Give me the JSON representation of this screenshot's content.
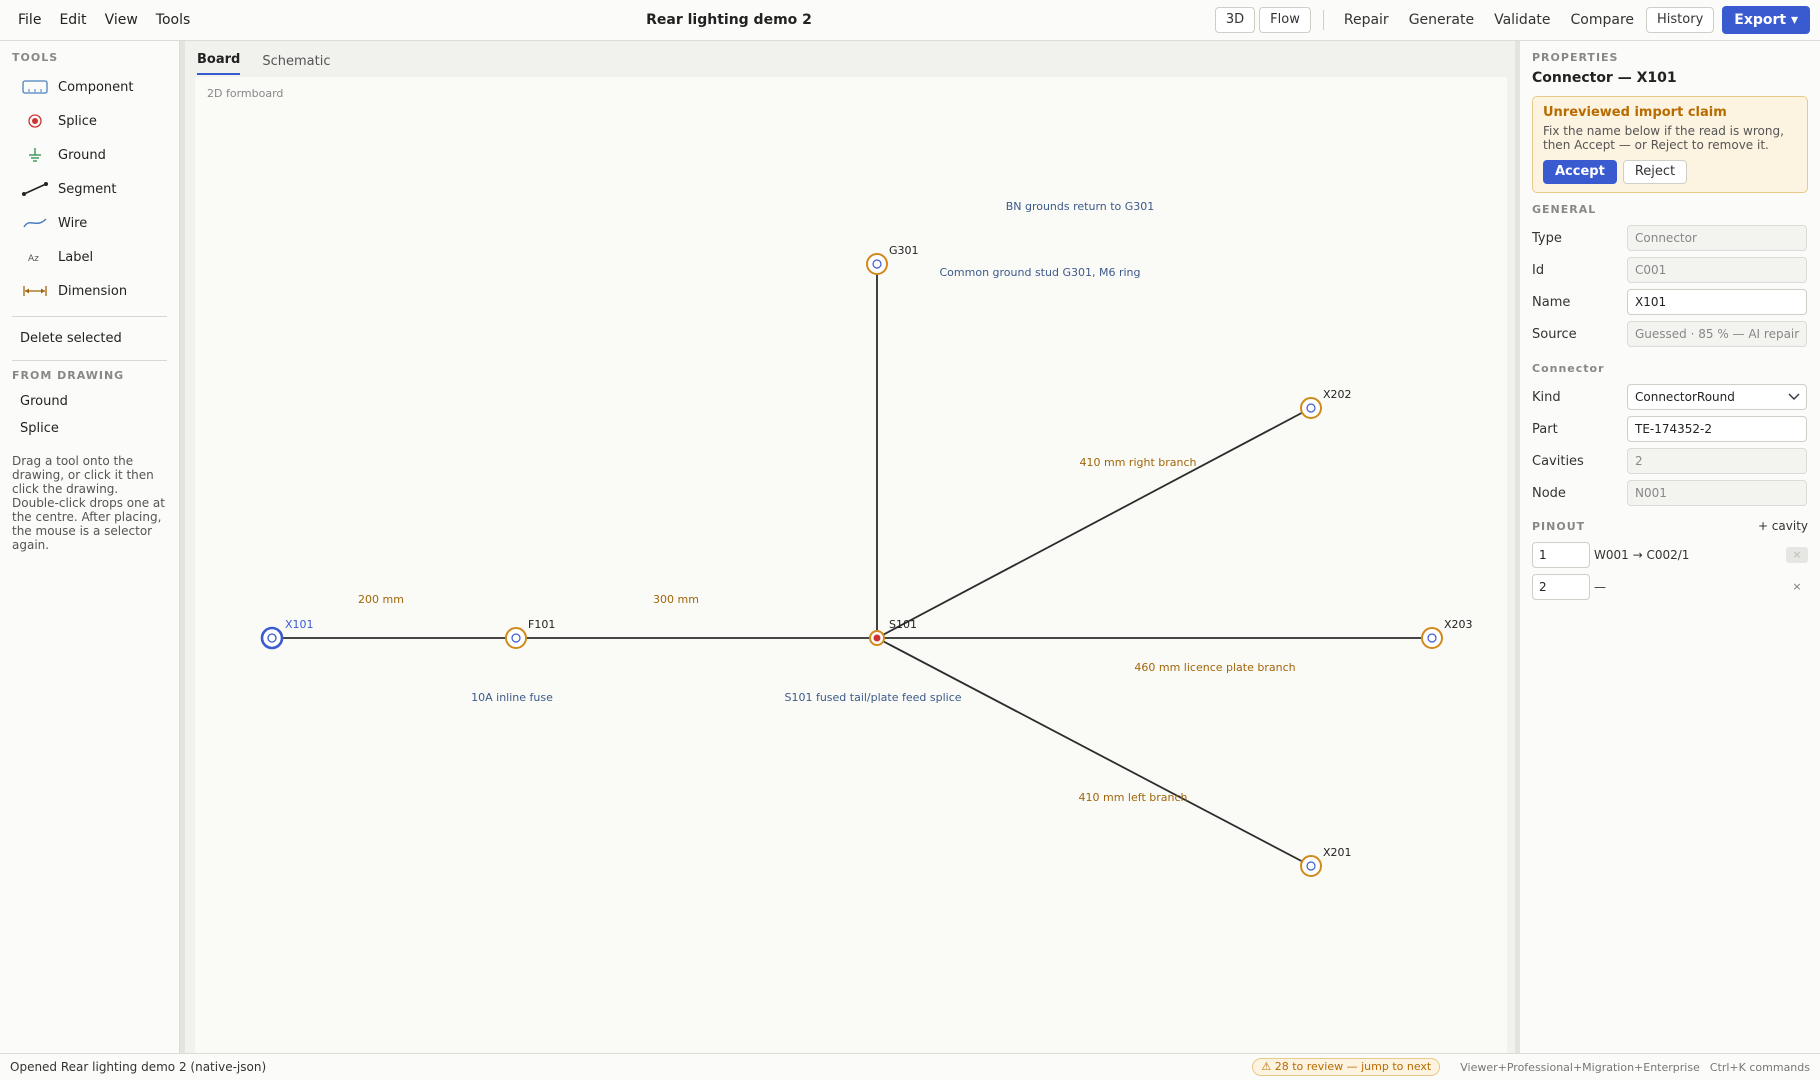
{
  "menu": [
    "File",
    "Edit",
    "View",
    "Tools"
  ],
  "doc_title": "Rear lighting demo 2",
  "toolbar": {
    "view_3d": "3D",
    "flow": "Flow",
    "repair": "Repair",
    "generate": "Generate",
    "validate": "Validate",
    "compare": "Compare",
    "history": "History",
    "export": "Export ▾"
  },
  "left": {
    "tools_heading": "TOOLS",
    "tools": [
      {
        "label": "Component",
        "icon": "component-icon"
      },
      {
        "label": "Splice",
        "icon": "splice-icon"
      },
      {
        "label": "Ground",
        "icon": "ground-icon"
      },
      {
        "label": "Segment",
        "icon": "segment-icon"
      },
      {
        "label": "Wire",
        "icon": "wire-icon"
      },
      {
        "label": "Label",
        "icon": "label-icon"
      },
      {
        "label": "Dimension",
        "icon": "dimension-icon"
      }
    ],
    "delete_selected": "Delete selected",
    "from_drawing_heading": "FROM DRAWING",
    "from_drawing": [
      "Ground",
      "Splice"
    ],
    "help": "Drag a tool onto the drawing, or click it then click the drawing. Double-click drops one at the centre. After placing, the mouse is a selector again."
  },
  "center": {
    "tabs": [
      "Board",
      "Schematic"
    ],
    "active_tab": "Board",
    "canvas_label": "2D formboard",
    "nodes": {
      "X101": "X101",
      "F101": "F101",
      "S101": "S101",
      "G301": "G301",
      "X202": "X202",
      "X203": "X203",
      "X201": "X201"
    },
    "segment_labels": {
      "x101_f101": "200 mm",
      "f101_s101": "300 mm",
      "s101_x202": "410 mm right branch",
      "s101_x203": "460 mm licence plate branch",
      "s101_x201": "410 mm left branch"
    },
    "notes": {
      "bn_grounds": "BN grounds return to G301",
      "g301_note": "Common ground stud G301, M6 ring",
      "fuse_note": "10A inline fuse",
      "splice_note": "S101 fused tail/plate feed splice"
    },
    "colors": {
      "node_ring": "#d08a1c",
      "selected_ring": "#3a5bd0",
      "splice_dot": "#cc3333",
      "segment": "#2c2c2c",
      "segment_label": "#a0660a",
      "note": "#3c5a8a"
    }
  },
  "properties": {
    "heading": "PROPERTIES",
    "title": "Connector — X101",
    "claim": {
      "title": "Unreviewed import claim",
      "text": "Fix the name below if the read is wrong, then Accept — or Reject to remove it.",
      "accept": "Accept",
      "reject": "Reject"
    },
    "general_heading": "GENERAL",
    "general": {
      "type_label": "Type",
      "type_value": "Connector",
      "id_label": "Id",
      "id_value": "C001",
      "name_label": "Name",
      "name_value": "X101",
      "source_label": "Source",
      "source_value": "Guessed · 85 % — AI repair"
    },
    "connector_heading": "Connector",
    "connector": {
      "kind_label": "Kind",
      "kind_value": "ConnectorRound",
      "part_label": "Part",
      "part_value": "TE-174352-2",
      "cavities_label": "Cavities",
      "cavities_value": "2",
      "node_label": "Node",
      "node_value": "N001"
    },
    "pinout_heading": "PINOUT",
    "add_cavity": "+ cavity",
    "pins": [
      {
        "num": "1",
        "text": "W001 → C002/1"
      },
      {
        "num": "2",
        "text": "—"
      }
    ]
  },
  "status": {
    "message": "Opened Rear lighting demo 2 (native-json)",
    "review": "⚠ 28 to review — jump to next",
    "edition": "Viewer+Professional+Migration+Enterprise",
    "shortcut": "Ctrl+K commands"
  }
}
